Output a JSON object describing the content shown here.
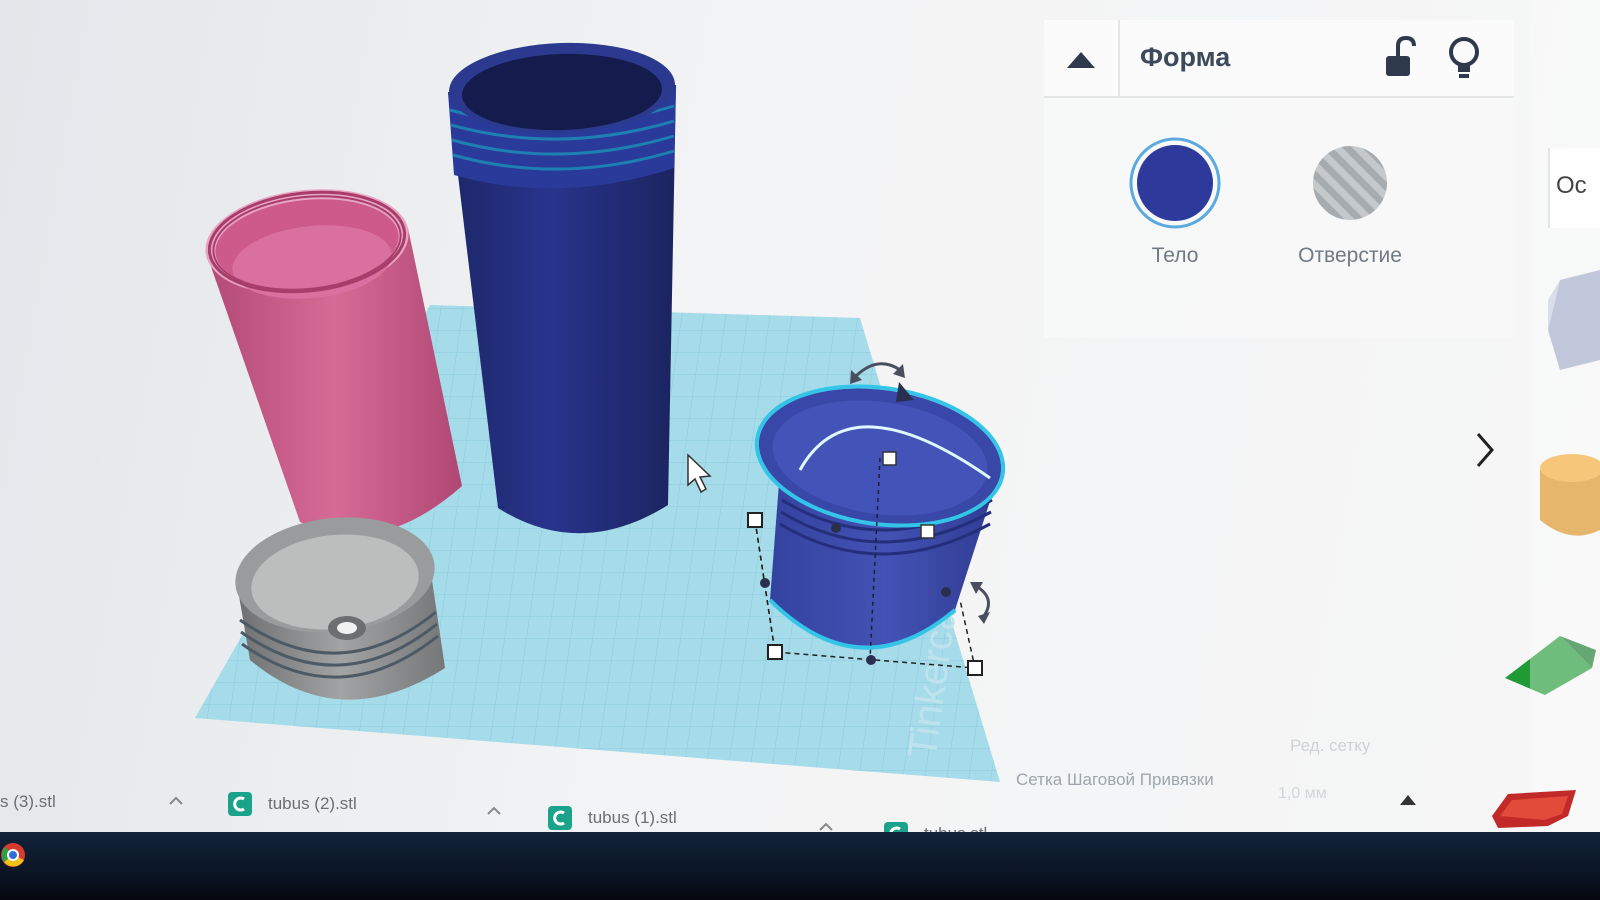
{
  "panel": {
    "title": "Форма",
    "solid_label": "Тело",
    "hole_label": "Отверстие"
  },
  "right_tab_label": "Ос",
  "grid": {
    "edit_label": "Ред. сетку",
    "snap_label": "Сетка Шаговой Привязки",
    "snap_value": "1,0 мм"
  },
  "downloads": [
    {
      "name": "s (3).stl"
    },
    {
      "name": "tubus (2).stl"
    },
    {
      "name": "tubus (1).stl"
    },
    {
      "name": "tubus.stl"
    }
  ],
  "colors": {
    "solid": "#2d3a9c",
    "pink": "#c65a86",
    "navy": "#232e7a",
    "grid": "#9fd6e6",
    "selection": "#33c5e8",
    "gray_part": "#8d8e8f"
  }
}
